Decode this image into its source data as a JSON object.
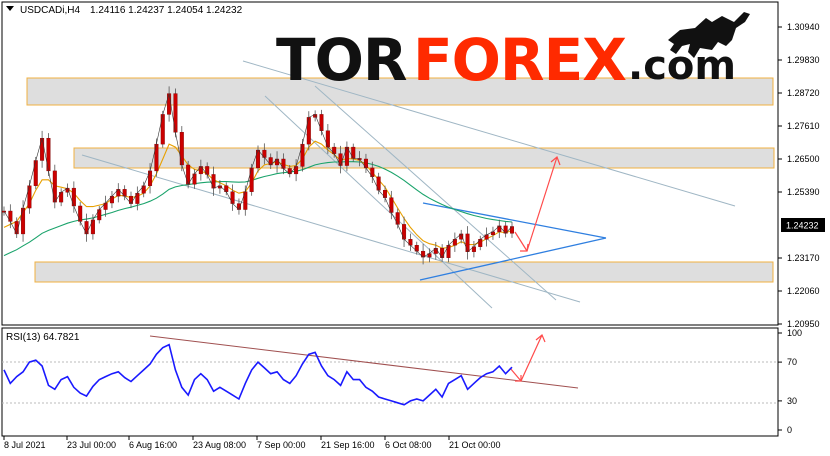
{
  "header": {
    "symbol": "USDCADi,H4",
    "ohlc": "1.24116 1.24237 1.24054 1.24232"
  },
  "logo": {
    "part1": "TOR",
    "part2": "FOREX",
    "part3": ".com",
    "colors": {
      "dark": "#111111",
      "accent": "#ff2a00"
    }
  },
  "rsi_panel": {
    "label": "RSI(13) 64.7821",
    "levels": [
      "100",
      "70",
      "30",
      "0"
    ]
  },
  "chart_data": [
    {
      "type": "line",
      "title": "USDCADi,H4",
      "subtitle": "1.24116 1.24237 1.24054 1.24232",
      "ylim": [
        1.2085,
        1.3145
      ],
      "y_ticks": [
        "1.30940",
        "1.29830",
        "1.28720",
        "1.27610",
        "1.26500",
        "1.25390",
        "1.24232",
        "1.23170",
        "1.22060",
        "1.20950"
      ],
      "current_price": "1.24232",
      "x_ticks": [
        "8 Jul 2021",
        "23 Jul 00:00",
        "6 Aug 16:00",
        "23 Aug 08:00",
        "7 Sep 00:00",
        "21 Sep 16:00",
        "6 Oct 08:00",
        "21 Oct 00:00"
      ],
      "colors": {
        "candle": "#cc0000",
        "ma_fast": "#e8a000",
        "ma_slow": "#1aa36b",
        "zones": "#e0e0e0",
        "zone_border": "#e8a000",
        "arrow": "#ff4040",
        "triangle": "#2f7fe0"
      },
      "series": [
        {
          "values": [
            1.2475,
            1.244,
            1.2398,
            1.2485,
            1.256,
            1.2645,
            1.272,
            1.261,
            1.2505,
            1.2538,
            1.2552,
            1.2492,
            1.244,
            1.2398,
            1.2445,
            1.248,
            1.2502,
            1.2525,
            1.2548,
            1.2525,
            1.25,
            1.2535,
            1.256,
            1.261,
            1.27,
            1.28,
            1.287,
            1.274,
            1.263,
            1.2565,
            1.26,
            1.2625,
            1.2598,
            1.2552,
            1.256,
            1.254,
            1.25,
            1.248,
            1.254,
            1.262,
            1.268,
            1.2655,
            1.263,
            1.265,
            1.2618,
            1.26,
            1.2625,
            1.27,
            1.279,
            1.28,
            1.2745,
            1.269,
            1.2668,
            1.2628,
            1.269,
            1.2652,
            1.265,
            1.262,
            1.259,
            1.2545,
            1.252,
            1.247,
            1.243,
            1.238,
            1.236,
            1.234,
            1.232,
            1.2332,
            1.235,
            1.2318,
            1.236,
            1.238,
            1.2398,
            1.2338,
            1.2355,
            1.238,
            1.2395,
            1.2405,
            1.2425,
            1.24,
            1.2423
          ]
        },
        {
          "values": [
            1.242,
            1.243,
            1.244,
            1.247,
            1.25,
            1.2545,
            1.258,
            1.258,
            1.256,
            1.2555,
            1.255,
            1.2535,
            1.251,
            1.249,
            1.249,
            1.2495,
            1.25,
            1.2515,
            1.2528,
            1.2526,
            1.252,
            1.2525,
            1.2535,
            1.256,
            1.26,
            1.265,
            1.27,
            1.269,
            1.266,
            1.263,
            1.2615,
            1.261,
            1.26,
            1.258,
            1.257,
            1.256,
            1.2545,
            1.2535,
            1.254,
            1.257,
            1.261,
            1.263,
            1.2635,
            1.264,
            1.2632,
            1.2625,
            1.2628,
            1.265,
            1.269,
            1.271,
            1.27,
            1.268,
            1.2665,
            1.2645,
            1.2652,
            1.265,
            1.2645,
            1.263,
            1.2605,
            1.258,
            1.2555,
            1.252,
            1.2485,
            1.245,
            1.242,
            1.2395,
            1.2375,
            1.2365,
            1.236,
            1.235,
            1.2352,
            1.236,
            1.2372,
            1.2362,
            1.2362,
            1.237,
            1.2382,
            1.2392,
            1.2405,
            1.2402,
            1.241
          ]
        },
        {
          "values": [
            1.2325,
            1.2335,
            1.2345,
            1.2358,
            1.237,
            1.2385,
            1.24,
            1.241,
            1.2418,
            1.2426,
            1.2434,
            1.244,
            1.2445,
            1.2448,
            1.2452,
            1.2458,
            1.2464,
            1.247,
            1.2477,
            1.2483,
            1.2488,
            1.2494,
            1.25,
            1.2508,
            1.2518,
            1.2532,
            1.2548,
            1.2556,
            1.2561,
            1.2564,
            1.2567,
            1.257,
            1.2572,
            1.2573,
            1.2574,
            1.2574,
            1.2573,
            1.2572,
            1.2573,
            1.2578,
            1.2585,
            1.2591,
            1.2596,
            1.2601,
            1.2604,
            1.2606,
            1.2609,
            1.2614,
            1.2622,
            1.263,
            1.2635,
            1.2638,
            1.264,
            1.264,
            1.2641,
            1.2641,
            1.264,
            1.2637,
            1.2632,
            1.2625,
            1.2616,
            1.2605,
            1.2592,
            1.2578,
            1.2562,
            1.2546,
            1.2531,
            1.2518,
            1.2507,
            1.2497,
            1.2488,
            1.248,
            1.2473,
            1.2466,
            1.246,
            1.2455,
            1.245,
            1.2446,
            1.2443,
            1.244,
            1.2438
          ]
        }
      ]
    },
    {
      "type": "line",
      "title": "RSI(13) 64.7821",
      "ylim": [
        0,
        100
      ],
      "y_ticks": [
        "100",
        "70",
        "30",
        "0"
      ],
      "series": [
        {
          "values": [
            62,
            48,
            55,
            60,
            70,
            72,
            66,
            46,
            42,
            52,
            55,
            44,
            38,
            35,
            45,
            52,
            55,
            58,
            60,
            54,
            50,
            56,
            62,
            68,
            78,
            85,
            88,
            62,
            44,
            36,
            52,
            58,
            52,
            40,
            44,
            40,
            36,
            32,
            48,
            62,
            70,
            64,
            58,
            60,
            52,
            48,
            56,
            68,
            78,
            80,
            66,
            56,
            52,
            46,
            60,
            52,
            52,
            44,
            40,
            34,
            32,
            30,
            28,
            26,
            30,
            32,
            30,
            36,
            42,
            34,
            48,
            52,
            56,
            42,
            48,
            54,
            58,
            60,
            66,
            58,
            64.78
          ]
        }
      ]
    }
  ]
}
